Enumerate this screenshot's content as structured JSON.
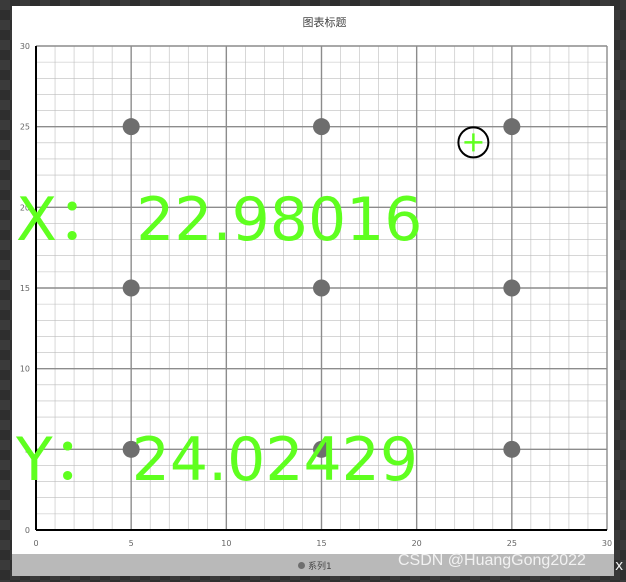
{
  "readout": {
    "x_label": "X：",
    "x_value": "22.98016",
    "y_label": "Y：",
    "y_value": "24.02429"
  },
  "watermark": "CSDN @HuangGong2022",
  "close_label": "x",
  "colors": {
    "readout": "#5fff1f",
    "marker": "#6e6e6e",
    "axis": "#000000",
    "grid_major": "#8c8c8c",
    "grid_minor": "#bdbdbd"
  },
  "chart_data": {
    "type": "scatter",
    "title": "图表标题",
    "xlabel": "",
    "ylabel": "",
    "xlim": [
      0,
      30
    ],
    "ylim": [
      0,
      30
    ],
    "x_ticks": [
      "0",
      "5",
      "10",
      "15",
      "20",
      "25",
      "30"
    ],
    "y_ticks": [
      "0",
      "5",
      "10",
      "15",
      "20",
      "25",
      "30"
    ],
    "grid": true,
    "legend_position": "bottom",
    "series": [
      {
        "name": "系列1",
        "points": [
          {
            "x": 5,
            "y": 5
          },
          {
            "x": 15,
            "y": 5
          },
          {
            "x": 25,
            "y": 5
          },
          {
            "x": 5,
            "y": 15
          },
          {
            "x": 15,
            "y": 15
          },
          {
            "x": 25,
            "y": 15
          },
          {
            "x": 5,
            "y": 25
          },
          {
            "x": 15,
            "y": 25
          },
          {
            "x": 25,
            "y": 25
          }
        ]
      }
    ],
    "cursor": {
      "x": 22.98016,
      "y": 24.02429
    }
  }
}
